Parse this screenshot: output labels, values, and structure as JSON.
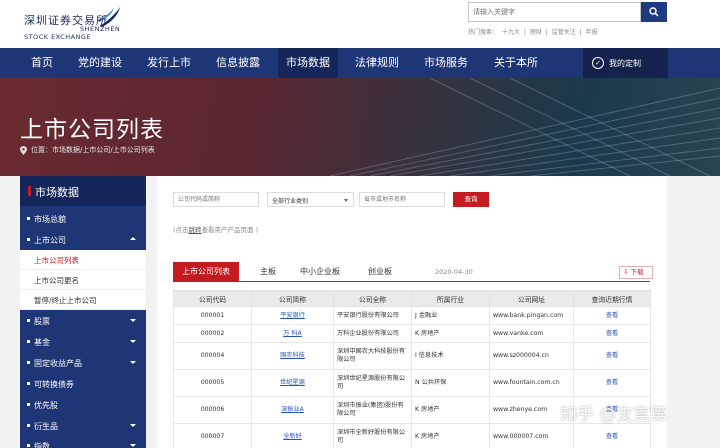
{
  "logo": {
    "cn": "深圳证券交易所",
    "en_line1": "SHENZHEN",
    "en_line2": "STOCK EXCHANGE"
  },
  "search": {
    "placeholder": "请输入关键字"
  },
  "hotwords": [
    "",
    "十九大",
    "|",
    "理财",
    "|",
    "监管关注",
    "|",
    "年报"
  ],
  "hotwords_label": "热门搜索：",
  "nav": [
    "首页",
    "党的建设",
    "发行上市",
    "信息披露",
    "市场数据",
    "法律规则",
    "市场服务",
    "关于本所"
  ],
  "nav_active": "市场数据",
  "nav_mine": "我的定制",
  "banner": {
    "title": "上市公司列表",
    "breadcrumb": "位置：市场数据/上市公司/上市公司列表"
  },
  "sidebar": {
    "header": "市场数据",
    "items": [
      {
        "label": "市场总貌",
        "caret": ""
      },
      {
        "label": "上市公司",
        "caret": "up"
      },
      {
        "label": "股票",
        "caret": "down"
      },
      {
        "label": "基金",
        "caret": "down"
      },
      {
        "label": "固定收益产品",
        "caret": "down"
      },
      {
        "label": "可转换债券",
        "caret": ""
      },
      {
        "label": "优先股",
        "caret": ""
      },
      {
        "label": "衍生品",
        "caret": "down"
      },
      {
        "label": "指数",
        "caret": "down"
      }
    ],
    "sub_items": [
      "上市公司列表",
      "上市公司更名",
      "暂停/终止上市公司"
    ]
  },
  "filter": {
    "code_placeholder": "公司代码或简称",
    "industry": "全部行业类别",
    "region_placeholder": "省市或地市名称",
    "query_button": "查询"
  },
  "note": {
    "prefix": "(点击",
    "link": "跳转",
    "suffix": "查看资产产品页面 )"
  },
  "tabs": [
    "上市公司列表",
    "主板",
    "中小企业板",
    "创业板"
  ],
  "date": "2020-04-30",
  "download": "下载",
  "table": {
    "headers": [
      "公司代码",
      "公司简称",
      "公司全称",
      "所属行业",
      "公司网址",
      "查询近期行情"
    ],
    "rows": [
      [
        "000001",
        "平安银行",
        "平安银行股份有限公司",
        "J 金融业",
        "www.bank.pingan.com",
        "查看"
      ],
      [
        "000002",
        "万 科A",
        "万科企业股份有限公司",
        "K 房地产",
        "www.vanke.com",
        "查看"
      ],
      [
        "000004",
        "国农科技",
        "深圳中国农大科技股份有限公司",
        "I 信息技术",
        "www.sz000004.cn",
        "查看"
      ],
      [
        "000005",
        "世纪星源",
        "深圳世纪星源股份有限公司",
        "N 公共环保",
        "www.fountain.com.cn",
        "查看"
      ],
      [
        "000006",
        "深振业A",
        "深圳市振业(集团)股份有限公司",
        "K 房地产",
        "www.zhenye.com",
        "查看"
      ],
      [
        "000007",
        "全新好",
        "深圳市全新好股份有限公司",
        "K 房地产",
        "www.000007.com",
        "查看"
      ]
    ]
  },
  "watermark": "知乎 @支宫第",
  "colors": {
    "nav": "#1e3576",
    "accent": "#c41b21",
    "link": "#2a55b8"
  }
}
